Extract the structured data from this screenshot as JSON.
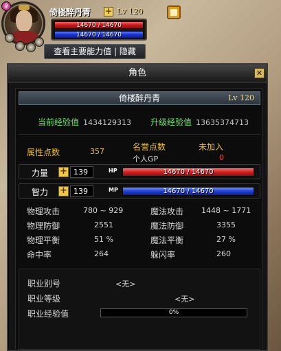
{
  "hud": {
    "name": "倚楼醉丹青",
    "level": "Lv 120",
    "hp": "14670 / 14670",
    "mp": "14670 / 14670",
    "toggle_button": "查看主要能力值 | 隐藏"
  },
  "window": {
    "title": "角色",
    "close": "✕",
    "character_name": "倚楼醉丹青",
    "level": "Lv 120",
    "current_exp_label": "当前经验值",
    "current_exp_value": "1434129313",
    "upgrade_exp_label": "升级经验值",
    "upgrade_exp_value": "13635374713",
    "attr_points_label": "属性点数",
    "attr_points_value": "357",
    "honor_label": "名誉点数",
    "honor_value": "未加入",
    "gp_label": "个人GP",
    "gp_value": "0",
    "str_label": "力量",
    "str_value": "139",
    "hp_tag": "HP",
    "hp_bar": "14670 / 14670",
    "int_label": "智力",
    "int_value": "139",
    "mp_tag": "MP",
    "mp_bar": "14670 / 14670",
    "stats": {
      "phys_atk_label": "物理攻击",
      "phys_atk_value": "780 ~ 929",
      "mag_atk_label": "魔法攻击",
      "mag_atk_value": "1448 ~ 1771",
      "phys_def_label": "物理防御",
      "phys_def_value": "2551",
      "mag_def_label": "魔法防御",
      "mag_def_value": "3355",
      "phys_bal_label": "物理平衡",
      "phys_bal_value": "51 %",
      "mag_bal_label": "魔法平衡",
      "mag_bal_value": "27 %",
      "hit_label": "命中率",
      "hit_value": "264",
      "dodge_label": "躲闪率",
      "dodge_value": "260"
    },
    "job": {
      "alias_label": "职业别号",
      "alias_value": "<无>",
      "level_label": "职业等级",
      "level_value": "<无>",
      "exp_label": "职业经验值",
      "exp_value": "0%"
    }
  }
}
